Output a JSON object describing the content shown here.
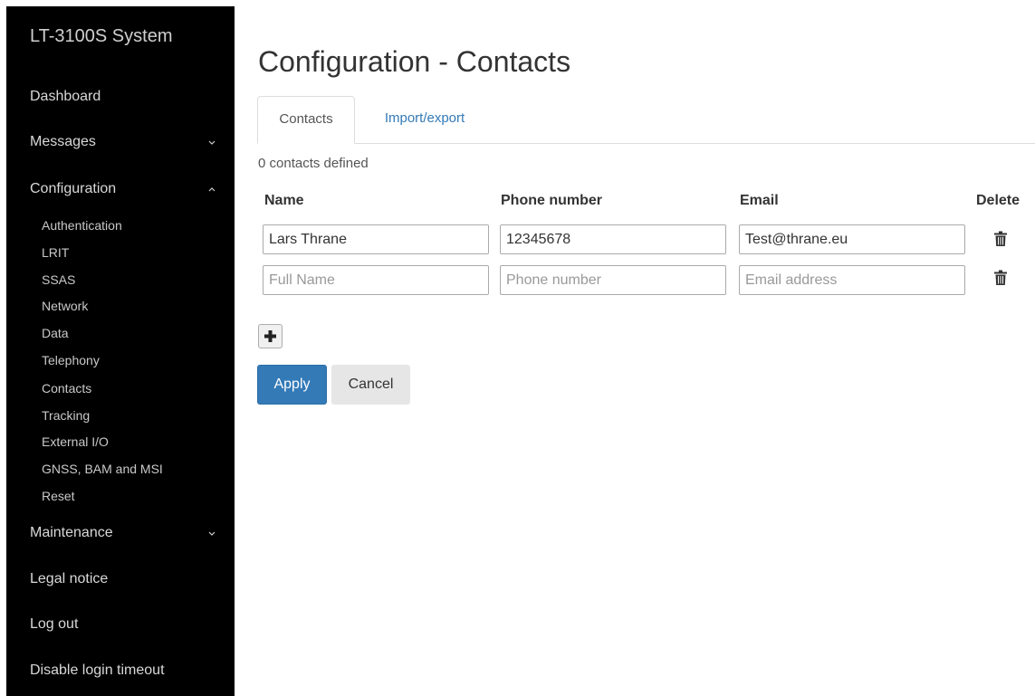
{
  "sidebar": {
    "brand": "LT-3100S System",
    "nav": {
      "dashboard": "Dashboard",
      "messages": "Messages",
      "configuration": "Configuration",
      "maintenance": "Maintenance",
      "legal_notice": "Legal notice",
      "log_out": "Log out",
      "disable_login_timeout": "Disable login timeout"
    },
    "config_items": [
      "Authentication",
      "LRIT",
      "SSAS",
      "Network",
      "Data",
      "Telephony",
      "Contacts",
      "Tracking",
      "External I/O",
      "GNSS, BAM and MSI",
      "Reset"
    ]
  },
  "main": {
    "title": "Configuration - Contacts",
    "tabs": [
      {
        "label": "Contacts",
        "active": true
      },
      {
        "label": "Import/export",
        "active": false
      }
    ],
    "count_text": "0 contacts defined",
    "columns": {
      "name": "Name",
      "phone": "Phone number",
      "email": "Email",
      "delete": "Delete"
    },
    "rows": [
      {
        "name": "Lars Thrane",
        "phone": "12345678",
        "email": "Test@thrane.eu",
        "name_placeholder": "Full Name",
        "phone_placeholder": "Phone number",
        "email_placeholder": "Email address"
      },
      {
        "name": "",
        "phone": "",
        "email": "",
        "name_placeholder": "Full Name",
        "phone_placeholder": "Phone number",
        "email_placeholder": "Email address"
      }
    ],
    "add_icon": "plus-icon",
    "delete_icon": "trash-icon",
    "buttons": {
      "apply": "Apply",
      "cancel": "Cancel"
    }
  },
  "colors": {
    "sidebar_bg": "#000000",
    "primary": "#337ab7",
    "link": "#337ab7",
    "default_button": "#e6e6e6"
  }
}
